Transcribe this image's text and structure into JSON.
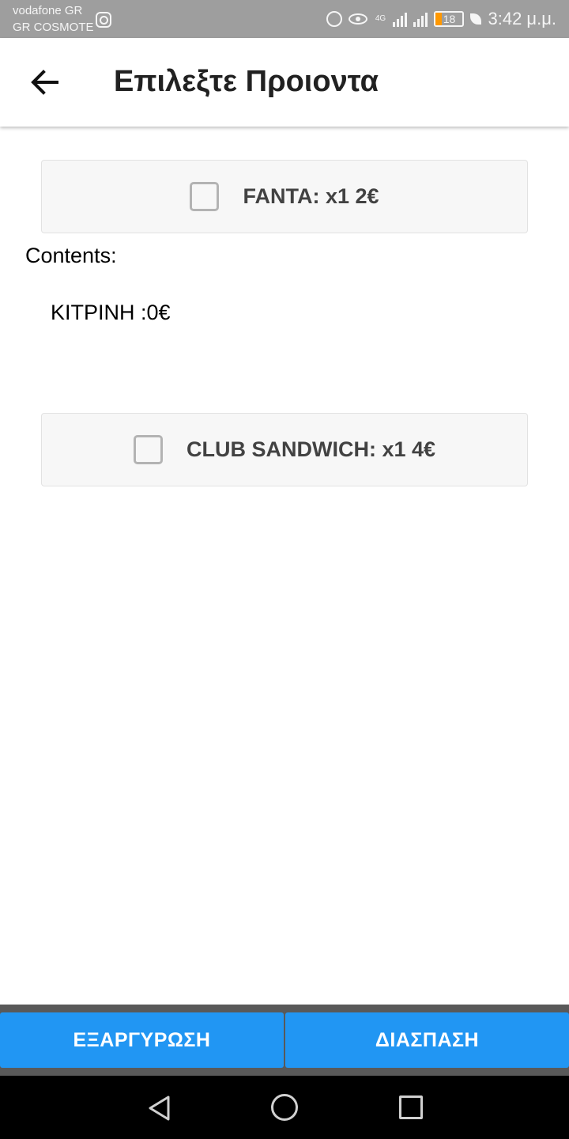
{
  "status_bar": {
    "carrier_primary": "vodafone GR",
    "carrier_secondary": "GR COSMOTE",
    "network_type": "4G",
    "battery_level": "18",
    "time": "3:42 μ.μ.",
    "icons": [
      "instagram-icon",
      "alarm-icon",
      "eye-icon",
      "signal-icon",
      "battery-icon",
      "leaf-icon"
    ]
  },
  "header": {
    "title": "Επιλεξτε Προιοντα",
    "back_icon": "arrow-left-icon"
  },
  "products": [
    {
      "label": "FANTA: x1 2€",
      "checked": false
    },
    {
      "label": "CLUB SANDWICH: x1 4€",
      "checked": false
    }
  ],
  "contents": {
    "heading": "Contents:",
    "items": [
      "ΚΙΤΡΙΝΗ :0€"
    ]
  },
  "actions": {
    "redeem_label": "ΕΞΑΡΓΥΡΩΣΗ",
    "split_label": "ΔΙΑΣΠΑΣΗ"
  },
  "colors": {
    "status_bar": "#9e9e9e",
    "accent": "#2196f3",
    "card_bg": "#f7f7f7",
    "battery_low": "#ff9800"
  }
}
